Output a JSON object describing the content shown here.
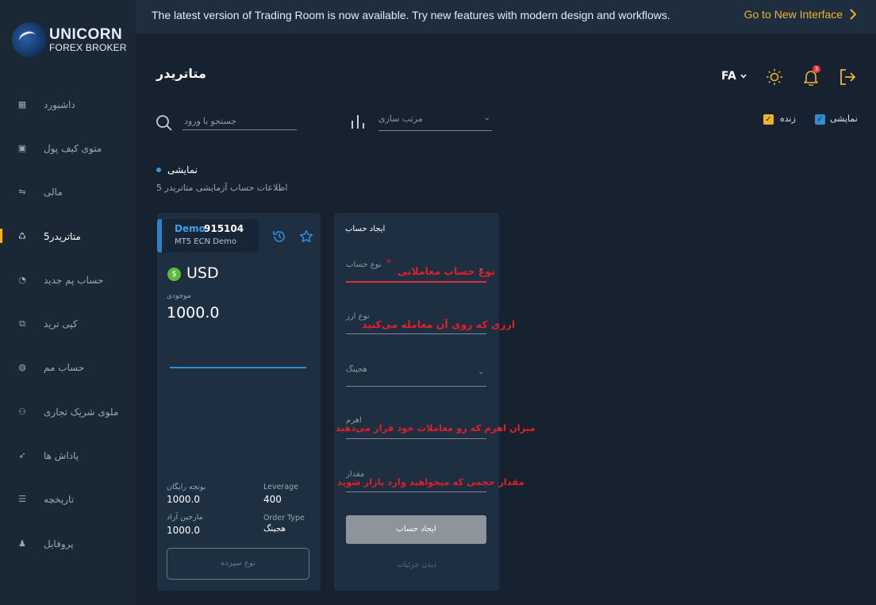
{
  "brand": {
    "name": "UNICORN",
    "subtitle": "FOREX BROKER"
  },
  "banner": {
    "text": "The latest version of Trading Room is now available. Try new features with modern design and workflows.",
    "link_label": "Go to New Interface"
  },
  "sidebar": {
    "items": [
      {
        "label": "داشبورد",
        "icon": "grid-icon"
      },
      {
        "label": "متوی کیف پول",
        "icon": "wallet-icon"
      },
      {
        "label": "مالی",
        "icon": "transfer-icon"
      },
      {
        "label": "متاتریدر5",
        "icon": "metatrader-icon",
        "active": true
      },
      {
        "label": "حساب پم جدید",
        "icon": "clock-icon"
      },
      {
        "label": "کپی ترید",
        "icon": "copy-icon"
      },
      {
        "label": "حساب مم",
        "icon": "globe-icon"
      },
      {
        "label": "ملوی شریک تجاری",
        "icon": "partner-icon"
      },
      {
        "label": "پاداش ها",
        "icon": "rocket-icon"
      },
      {
        "label": "تاریخچه",
        "icon": "list-icon"
      },
      {
        "label": "پروفایل",
        "icon": "user-icon"
      }
    ]
  },
  "header": {
    "title": "متاتریدر",
    "language": "FA",
    "notification_count": "3"
  },
  "filters": {
    "search_placeholder": "جستجو با ورود",
    "sort_label": "مرتب سازی",
    "checkbox_live": "زنده",
    "checkbox_demo": "نمایشی"
  },
  "section": {
    "title": "نمایشی",
    "subtitle": "اطلاعات حساب آزمایشی متاتریدر 5"
  },
  "account": {
    "label": "Demo",
    "number": "915104",
    "type": "MT5 ECN Demo",
    "currency": "USD",
    "balance_label": "موجودی",
    "balance": "1000.0",
    "stats": {
      "free_bonus_label": "بونجه رایگان",
      "free_bonus": "1000.0",
      "leverage_label": "Leverage",
      "leverage": "400",
      "free_margin_label": "مارجین آزاد",
      "free_margin": "1000.0",
      "order_type_label": "Order Type",
      "order_type": "هجینگ"
    },
    "deposit_label": "نوع سپرده"
  },
  "create_form": {
    "title": "ایجاد حساب",
    "fields": {
      "account_type_label": "نوع حساب",
      "account_type_note": "نوع حساب معاملاتی",
      "currency_label": "نوع ارز",
      "currency_note": "ارزی که روی آن معامله می‌کنید",
      "hedging_label": "هجینگ",
      "leverage_label": "اهرم",
      "leverage_note": "میزان اهرم که رو معاملات خود قرار می‌دهید",
      "amount_label": "مقدار",
      "amount_note": "مقدار حجمی که میخواهید وارد بازار شوید"
    },
    "submit_label": "ایجاد حساب",
    "details_label": "دیدن جزئیات"
  },
  "colors": {
    "background": "#16222f",
    "sidebar": "#1a2734",
    "accent_yellow": "#f0b429",
    "accent_blue": "#2f9ae0",
    "annotation_red": "#e0202a"
  }
}
